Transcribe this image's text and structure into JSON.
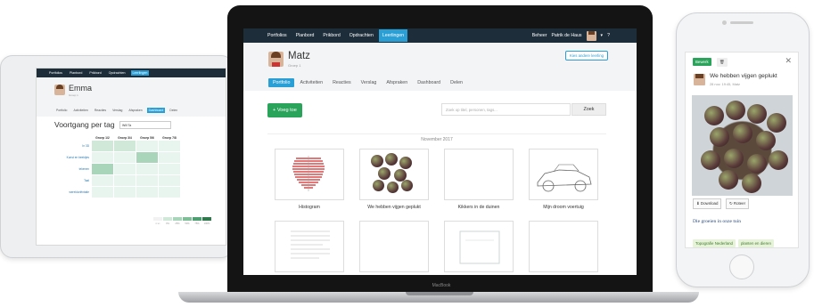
{
  "tablet": {
    "nav": [
      "Portfolios",
      "Planbord",
      "Prikbord",
      "Opdrachten",
      "Leerlingen"
    ],
    "nav_active": 4,
    "student_name": "Emma",
    "student_group": "Groep 1",
    "tabs": [
      "Portfolio",
      "Activiteiten",
      "Reacties",
      "Verslag",
      "Afspraken",
      "Dashboard",
      "Delen"
    ],
    "tabs_active": 5,
    "chart_title": "Voortgang per tag",
    "select_value": "Will Ta",
    "columns": [
      "Groep 1/2",
      "Groep 3/4",
      "Groep 5/6",
      "Groep 7/8"
    ],
    "rows": [
      "In 3D",
      "Kunst en beeldjes",
      "tekenen",
      "Taal",
      "wereldoriëntatie"
    ],
    "legend": [
      "n.v.t",
      "0%",
      "25%",
      "50%",
      "75%",
      "100%"
    ],
    "colors": {
      "nav": "#1d2d3a",
      "accent": "#2a9fd6",
      "heat": [
        "#e8f5ee",
        "#cfe8d8",
        "#a9d5ba",
        "#7fbf98",
        "#4f9e72",
        "#2e7a4d"
      ]
    }
  },
  "laptop": {
    "nav": [
      "Portfolios",
      "Planbord",
      "Prikbord",
      "Opdrachten",
      "Leerlingen"
    ],
    "nav_active": 4,
    "user_name": "Patrik de Haus",
    "admin_label": "Beheer",
    "student_name": "Matz",
    "student_group": "Groep 1",
    "other_student_button": "Kies andere leerling",
    "tabs": [
      "Portfolio",
      "Activiteiten",
      "Reacties",
      "Verslag",
      "Afspraken",
      "Dashboard",
      "Delen"
    ],
    "tabs_active": 0,
    "add_button": "+ Voeg toe",
    "search_placeholder": "Zoek op titel, personen, tags...",
    "search_button": "Zoek",
    "month": "November 2017",
    "items": [
      {
        "caption": "Histogram",
        "kind": "histo"
      },
      {
        "caption": "We hebben vijgen geplukt",
        "kind": "figs"
      },
      {
        "caption": "Kikkers in de duinen",
        "kind": "dunes"
      },
      {
        "caption": "Mijn droom voertuig",
        "kind": "car"
      },
      {
        "caption": "",
        "kind": "doc"
      },
      {
        "caption": "",
        "kind": "shed"
      },
      {
        "caption": "",
        "kind": "frame"
      },
      {
        "caption": "",
        "kind": "cloth"
      }
    ],
    "brand_label": "MacBook"
  },
  "phone": {
    "edit_button": "Bewerk",
    "delete_icon": "trash-icon",
    "title": "We hebben vijgen geplukt",
    "date": "28 nov. 19:45, Matz",
    "download_button": "Download",
    "rotate_button": "Roteer",
    "caption": "Die groeien in onze tuin",
    "tags": [
      "Topografie Nederland",
      "planten en dieren"
    ]
  }
}
